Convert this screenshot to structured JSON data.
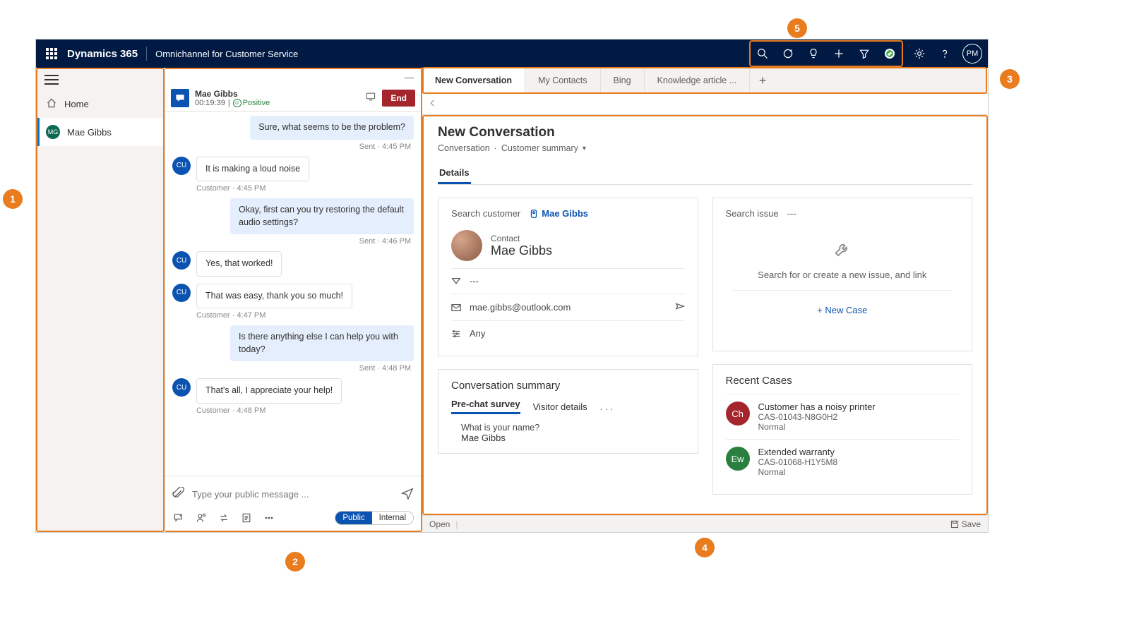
{
  "header": {
    "brand": "Dynamics 365",
    "app_name": "Omnichannel for Customer Service",
    "user_initials": "PM"
  },
  "sidebar": {
    "home_label": "Home",
    "items": [
      {
        "initials": "MG",
        "label": "Mae Gibbs"
      }
    ]
  },
  "conversation": {
    "customer_name": "Mae Gibbs",
    "timer": "00:19:39",
    "sentiment": "Positive",
    "end_label": "End",
    "messages": [
      {
        "from": "agent",
        "text": "Sure, what seems to be the problem?",
        "meta": "Sent · 4:45 PM"
      },
      {
        "from": "customer",
        "text": "It is making a loud noise",
        "meta": "Customer · 4:45 PM"
      },
      {
        "from": "agent",
        "text": "Okay, first can you try restoring the default audio settings?",
        "meta": "Sent · 4:46 PM"
      },
      {
        "from": "customer",
        "text": "Yes, that worked!",
        "meta": ""
      },
      {
        "from": "customer",
        "text": "That was easy, thank you so much!",
        "meta": "Customer · 4:47 PM"
      },
      {
        "from": "agent",
        "text": "Is there anything else I can help you with today?",
        "meta": "Sent · 4:48 PM"
      },
      {
        "from": "customer",
        "text": "That's all, I appreciate your help!",
        "meta": "Customer · 4:48 PM"
      }
    ],
    "compose_placeholder": "Type your public message ...",
    "toggle": {
      "public": "Public",
      "internal": "Internal"
    }
  },
  "tabs": [
    {
      "label": "New Conversation",
      "active": true
    },
    {
      "label": "My Contacts"
    },
    {
      "label": "Bing"
    },
    {
      "label": "Knowledge article ..."
    }
  ],
  "page": {
    "title": "New Conversation",
    "breadcrumb": {
      "a": "Conversation",
      "b": "Customer summary"
    },
    "details_tab": "Details",
    "search_customer_label": "Search customer",
    "customer_link": "Mae Gibbs",
    "contact_label": "Contact",
    "contact_name": "Mae Gibbs",
    "contact_rows": {
      "row1": "---",
      "row2": "mae.gibbs@outlook.com",
      "row3": "Any"
    },
    "search_issue_label": "Search issue",
    "issue_value": "---",
    "issue_empty": "Search for or create a new issue, and link",
    "new_case": "+ New Case",
    "recent_cases_title": "Recent Cases",
    "recent_cases": [
      {
        "initials": "Ch",
        "color": "#a4262c",
        "title": "Customer has a noisy printer",
        "case": "CAS-01043-N8G0H2",
        "priority": "Normal"
      },
      {
        "initials": "Ew",
        "color": "#2a7f3e",
        "title": "Extended warranty",
        "case": "CAS-01068-H1Y5M8",
        "priority": "Normal"
      }
    ],
    "conv_summary_title": "Conversation summary",
    "inner_tabs": {
      "a": "Pre-chat survey",
      "b": "Visitor details"
    },
    "q1": "What is your name?",
    "a1": "Mae Gibbs"
  },
  "statusbar": {
    "open": "Open",
    "save": "Save"
  },
  "callouts": {
    "c1": "1",
    "c2": "2",
    "c3": "3",
    "c4": "4",
    "c5": "5"
  }
}
